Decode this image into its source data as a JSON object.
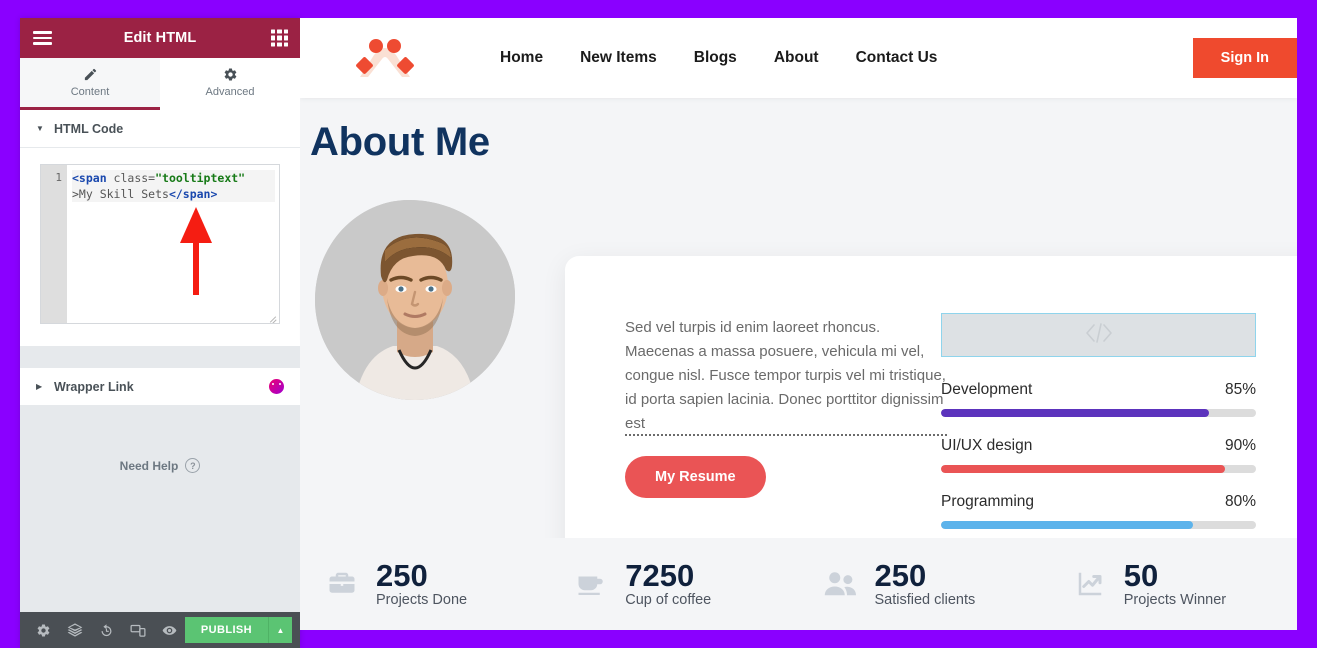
{
  "colors": {
    "frame_purple": "#8a00ff",
    "panel_header": "#9b2244",
    "publish_green": "#5bc473",
    "accent_orange": "#ef4a2e",
    "resume_red": "#ea5455",
    "title_navy": "#10335f"
  },
  "panel": {
    "title": "Edit HTML",
    "menu_icon": "hamburger-icon",
    "grid_icon": "apps-grid-icon",
    "tabs": [
      {
        "label": "Content",
        "icon": "pencil-icon",
        "active": true
      },
      {
        "label": "Advanced",
        "icon": "gear-icon",
        "active": false
      }
    ],
    "sections": [
      {
        "label": "HTML Code",
        "expanded": true
      },
      {
        "label": "Wrapper Link",
        "expanded": false,
        "badge": "dynamic-tags-icon"
      }
    ],
    "code_editor": {
      "line_number": "1",
      "tokens": {
        "tag_open": "<span",
        "attr": " class=",
        "attr_value": "\"tooltiptext\"",
        "gt_text": ">My Skill Sets",
        "tag_close": "</span>"
      }
    },
    "need_help": "Need Help",
    "footer": {
      "icons": [
        "settings-gear-icon",
        "navigator-layers-icon",
        "history-icon",
        "responsive-mode-icon",
        "preview-eye-icon"
      ],
      "publish_label": "PUBLISH",
      "publish_caret": "chevron-up-icon"
    },
    "collapse_handle": "chevron-left-icon"
  },
  "site": {
    "logo": "brand-logo",
    "nav": [
      {
        "label": "Home"
      },
      {
        "label": "New Items"
      },
      {
        "label": "Blogs"
      },
      {
        "label": "About"
      },
      {
        "label": "Contact Us"
      }
    ],
    "signin_label": "Sign In",
    "about": {
      "title": "About Me",
      "portrait": "profile-photo",
      "paragraph": "Sed vel turpis id enim laoreet rhoncus. Maecenas a massa posuere, vehicula mi vel, congue nisl. Fusce tempor turpis vel mi tristique, id porta sapien lacinia. Donec porttitor dignissim est",
      "resume_label": "My Resume",
      "html_widget_icon": "code-brackets-icon",
      "skills": [
        {
          "name": "Development",
          "pct_label": "85%",
          "value": 85,
          "color": "#5c33bd"
        },
        {
          "name": "UI/UX design",
          "pct_label": "90%",
          "value": 90,
          "color": "#ea5455"
        },
        {
          "name": "Programming",
          "pct_label": "80%",
          "value": 80,
          "color": "#5cb3eb"
        }
      ]
    },
    "stats": [
      {
        "icon": "briefcase-icon",
        "number": "250",
        "label": "Projects Done"
      },
      {
        "icon": "coffee-cup-icon",
        "number": "7250",
        "label": "Cup of coffee"
      },
      {
        "icon": "users-icon",
        "number": "250",
        "label": "Satisfied clients"
      },
      {
        "icon": "chart-line-up-icon",
        "number": "50",
        "label": "Projects Winner"
      }
    ]
  }
}
